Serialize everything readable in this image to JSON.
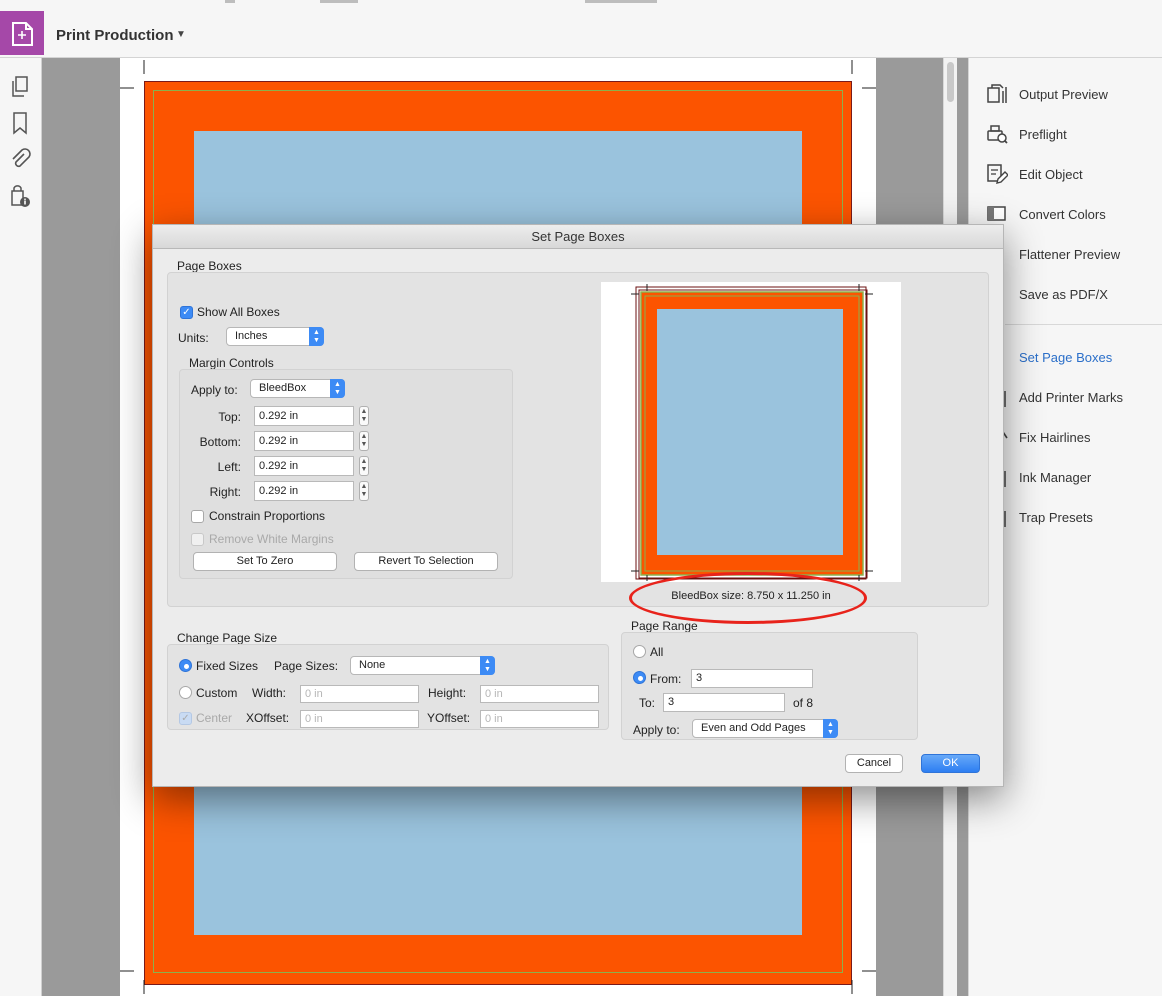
{
  "header": {
    "tool_name": "Print Production",
    "tool_icon": "print-production-tool-icon",
    "dropdown_icon": "caret-down-icon"
  },
  "left_nav": {
    "icons": [
      "pages-icon",
      "bookmark-icon",
      "attachment-icon",
      "security-info-icon"
    ],
    "collapse_icon": "collapse-left-arrow-icon"
  },
  "right_panel": {
    "items": [
      {
        "label": "Output Preview",
        "icon": "output-preview-icon"
      },
      {
        "label": "Preflight",
        "icon": "preflight-icon"
      },
      {
        "label": "Edit Object",
        "icon": "edit-object-icon"
      },
      {
        "label": "Convert Colors",
        "icon": "convert-colors-icon"
      },
      {
        "label": "Flattener Preview",
        "icon": "flattener-preview-icon"
      },
      {
        "label": "Save as PDF/X",
        "icon": "save-pdfx-icon"
      },
      {
        "label": "Set Page Boxes",
        "icon": "set-page-boxes-icon",
        "active": true
      },
      {
        "label": "Add Printer Marks",
        "icon": "printer-marks-icon"
      },
      {
        "label": "Fix Hairlines",
        "icon": "fix-hairlines-icon"
      },
      {
        "label": "Ink Manager",
        "icon": "ink-manager-icon"
      },
      {
        "label": "Trap Presets",
        "icon": "trap-presets-icon"
      }
    ],
    "active_color": "#2b6fc9"
  },
  "document": {
    "bleed_color": "#fc5400",
    "content_color": "#9ac3dd",
    "trim_color": "#8cb04c"
  },
  "dialog": {
    "title": "Set Page Boxes",
    "page_boxes": {
      "section_label": "Page Boxes",
      "show_all_boxes": {
        "label": "Show All Boxes",
        "checked": true
      },
      "units": {
        "label": "Units:",
        "value": "Inches"
      },
      "margin_controls": {
        "label": "Margin Controls",
        "apply_to": {
          "label": "Apply to:",
          "value": "BleedBox"
        },
        "fields": [
          {
            "label": "Top:",
            "value": "0.292 in"
          },
          {
            "label": "Bottom:",
            "value": "0.292 in"
          },
          {
            "label": "Left:",
            "value": "0.292 in"
          },
          {
            "label": "Right:",
            "value": "0.292 in"
          }
        ],
        "constrain_proportions": {
          "label": "Constrain Proportions",
          "checked": false
        },
        "remove_white_margins": {
          "label": "Remove White Margins",
          "checked": false,
          "disabled": true
        },
        "set_to_zero": "Set To Zero",
        "revert_to_selection": "Revert To Selection"
      },
      "preview_caption": "BleedBox size: 8.750 x 11.250 in"
    },
    "change_page_size": {
      "section_label": "Change Page Size",
      "fixed_sizes": {
        "label": "Fixed Sizes",
        "selected": true
      },
      "page_sizes": {
        "label": "Page Sizes:",
        "value": "None"
      },
      "custom": {
        "label": "Custom",
        "selected": false
      },
      "width": {
        "label": "Width:",
        "placeholder": "0 in"
      },
      "height": {
        "label": "Height:",
        "placeholder": "0 in"
      },
      "center": {
        "label": "Center",
        "checked": true,
        "disabled": true
      },
      "xoffset": {
        "label": "XOffset:",
        "placeholder": "0 in"
      },
      "yoffset": {
        "label": "YOffset:",
        "placeholder": "0 in"
      }
    },
    "page_range": {
      "section_label": "Page Range",
      "all": {
        "label": "All",
        "selected": false
      },
      "from": {
        "label": "From:",
        "value": "3",
        "selected": true
      },
      "to": {
        "label": "To:",
        "value": "3"
      },
      "of_total": "of 8",
      "apply_to": {
        "label": "Apply to:",
        "value": "Even and Odd Pages"
      }
    },
    "buttons": {
      "cancel": "Cancel",
      "ok": "OK"
    }
  },
  "annotation": {
    "color": "#e8231b"
  }
}
